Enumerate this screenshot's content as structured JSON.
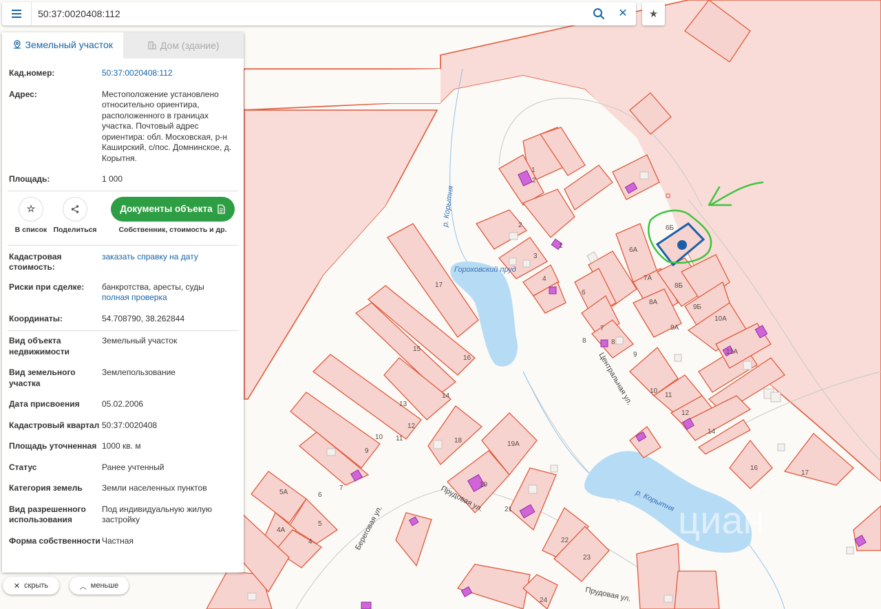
{
  "search": {
    "value": "50:37:0020408:112"
  },
  "icons": {
    "menu": "menu-icon",
    "search": "search-icon",
    "clear": "close-icon",
    "favorite": "star-icon",
    "share": "share-icon",
    "document": "document-icon",
    "parcel": "location-pin-icon",
    "building": "building-icon"
  },
  "tabs": [
    {
      "label": "Земельный участок",
      "active": true
    },
    {
      "label": "Дом (здание)",
      "active": false
    }
  ],
  "details_top": [
    {
      "key": "Кад.номер:",
      "value": "50:37:0020408:112",
      "link": true
    },
    {
      "key": "Адрес:",
      "value": "Местоположение установлено относительно ориентира, расположенного в границах участка. Почтовый адрес ориентира: обл. Московская, р-н Каширский, с/пос. Домнинское, д. Корытня."
    },
    {
      "key": "Площадь:",
      "value": "1 000"
    }
  ],
  "actions": {
    "add_to_list": "В список",
    "share": "Поделиться",
    "documents_button": "Документы объекта",
    "documents_sub": "Собственник, стоимость и др."
  },
  "details_mid": {
    "cadastral_value_key": "Кадастровая стоимость:",
    "cadastral_value_link": "заказать справку на дату",
    "risks_key": "Риски при сделке:",
    "risks_value": "банкротства, аресты, суды",
    "risks_link": "полная проверка",
    "coords_key": "Координаты:",
    "coords_value": "54.708790, 38.262844"
  },
  "details_bottom": [
    {
      "key": "Вид объекта недвижимости",
      "value": "Земельный участок"
    },
    {
      "key": "Вид земельного участка",
      "value": "Землепользование"
    },
    {
      "key": "Дата присвоения",
      "value": "05.02.2006"
    },
    {
      "key": "Кадастровый квартал",
      "value": "50:37:0020408"
    },
    {
      "key": "Площадь уточненная",
      "value": "1000 кв. м"
    },
    {
      "key": "Статус",
      "value": "Ранее учтенный"
    },
    {
      "key": "Категория земель",
      "value": "Земли населенных пунктов"
    },
    {
      "key": "Вид разрешенного использования",
      "value": "Под индивидуальную жилую застройку"
    },
    {
      "key": "Форма собственности",
      "value": "Частная"
    }
  ],
  "buttons": {
    "hide": "скрыть",
    "less": "меньше"
  },
  "map": {
    "colors": {
      "parcel_fill": "#f7d3cf",
      "parcel_stroke": "#e05a3c",
      "building": "#c95fd6",
      "water": "#b6dbf5",
      "selected": "#1a5fa8",
      "annotation": "#3ec43e"
    },
    "labels": [
      "1",
      "2",
      "3",
      "4",
      "5",
      "5A",
      "6",
      "6A",
      "6Б",
      "7",
      "7A",
      "8",
      "8A",
      "8Б",
      "9",
      "9Б",
      "9A",
      "10",
      "10A",
      "11",
      "11A",
      "12",
      "13",
      "14",
      "15",
      "16",
      "17",
      "18",
      "19",
      "19A",
      "21",
      "22",
      "23",
      "24",
      "4A"
    ],
    "street_labels": [
      "Центральная ул.",
      "Прудовая ул.",
      "Береговая ул.",
      "Прудовая ул."
    ],
    "water_labels": [
      "Гороховский пруд",
      "р. Корытня",
      "р. Корытня"
    ],
    "watermark": "циан"
  }
}
